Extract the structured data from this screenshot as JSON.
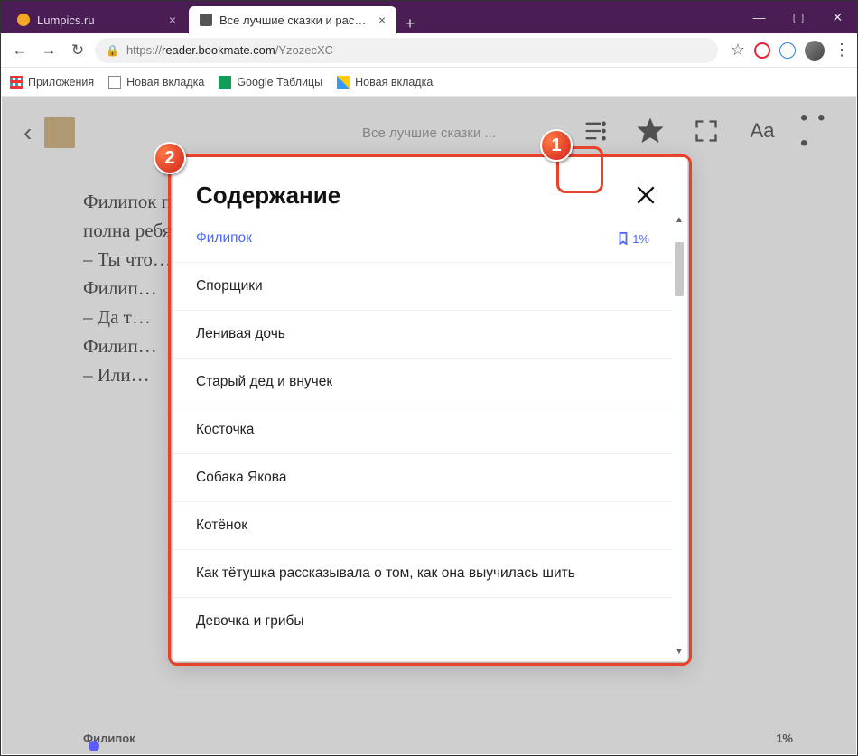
{
  "window_controls": {
    "min": "—",
    "max": "▢",
    "close": "✕"
  },
  "tabs": [
    {
      "title": "Lumpics.ru",
      "active": false
    },
    {
      "title": "Все лучшие сказки и рассказы",
      "active": true
    }
  ],
  "newtab_label": "+",
  "nav": {
    "back": "←",
    "forward": "→",
    "reload": "↻"
  },
  "url": {
    "scheme": "https://",
    "host": "reader.bookmate.com",
    "path": "/YzozecXC"
  },
  "omnibox_right": {
    "star": "☆",
    "menu": "⋮"
  },
  "bookmarks": [
    {
      "icon": "apps",
      "label": "Приложения"
    },
    {
      "icon": "doc",
      "label": "Новая вкладка"
    },
    {
      "icon": "sheet",
      "label": "Google Таблицы"
    },
    {
      "icon": "flag",
      "label": "Новая вкладка"
    }
  ],
  "reader": {
    "book_title_short": "Все лучшие сказки ...",
    "body_lines": [
      "Филипок пошел с ребятами в школу. А школа вся была",
      "полна ребят. Все кричали и сидели на середине.",
      "– Ты что…",
      "Филип…",
      "– Да т…",
      "Филип…",
      "– Или…"
    ],
    "footer_chapter": "Филипок",
    "footer_percent": "1%",
    "toolbar_icons": {
      "font": "Aa",
      "more": "• • •"
    }
  },
  "toc": {
    "title": "Содержание",
    "items": [
      {
        "label": "Филипок",
        "active": true,
        "bookmark_percent": "1%"
      },
      {
        "label": "Спорщики"
      },
      {
        "label": "Ленивая дочь"
      },
      {
        "label": "Старый дед и внучек"
      },
      {
        "label": "Косточка"
      },
      {
        "label": "Собака Якова"
      },
      {
        "label": "Котёнок"
      },
      {
        "label": "Как тётушка рассказывала о том, как она выучилась шить"
      },
      {
        "label": "Девочка и грибы"
      }
    ]
  },
  "callouts": {
    "one": "1",
    "two": "2"
  }
}
